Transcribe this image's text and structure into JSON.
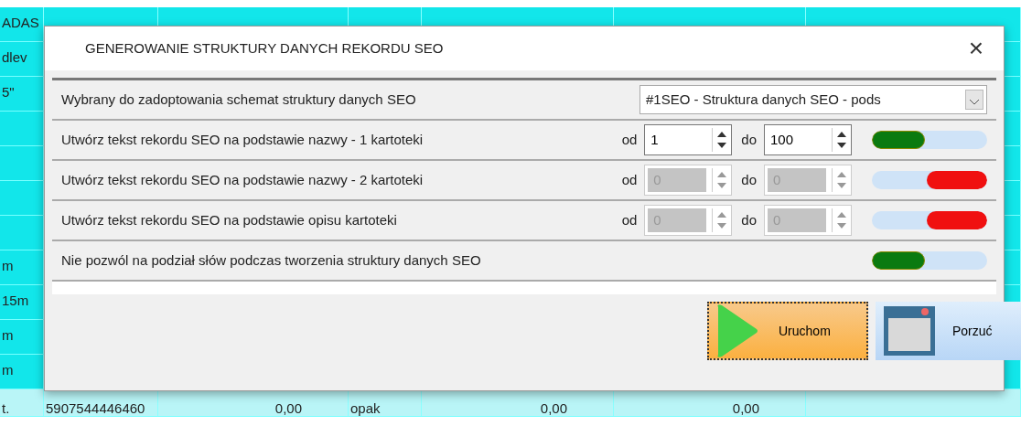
{
  "background_table": {
    "rows": [
      {
        "cells": [
          "ADAS",
          "",
          "",
          ""
        ]
      },
      {
        "cells": [
          "dlev",
          "",
          "",
          ""
        ]
      },
      {
        "cells": [
          "5\"",
          "",
          "",
          ""
        ]
      },
      {
        "cells": [
          "",
          "",
          "",
          ""
        ]
      },
      {
        "cells": [
          "",
          "",
          "",
          ""
        ]
      },
      {
        "cells": [
          "",
          "",
          "",
          ""
        ]
      },
      {
        "cells": [
          "",
          "",
          "",
          ""
        ]
      },
      {
        "cells": [
          "m",
          "",
          "",
          ""
        ]
      },
      {
        "cells": [
          "15m",
          "",
          "",
          ""
        ]
      },
      {
        "cells": [
          "m",
          "",
          "",
          ""
        ]
      },
      {
        "cells": [
          "m",
          "",
          "",
          ""
        ]
      },
      {
        "cells": [
          "t.",
          "5907544446460",
          "0,00",
          "opak",
          "0,00",
          "0,00"
        ]
      }
    ]
  },
  "dialog": {
    "title": "GENEROWANIE STRUKTURY DANYCH REKORDU SEO",
    "close": "×",
    "options": [
      {
        "kind": "select",
        "label": "Wybrany do zadoptowania schemat struktury danych SEO",
        "value": "#1SEO - Struktura danych SEO - pods"
      },
      {
        "kind": "range",
        "label": "Utwórz tekst rekordu SEO na podstawie nazwy - 1 kartoteki",
        "from_label": "od",
        "from": "1",
        "to_label": "do",
        "to": "100",
        "disabled": false,
        "on": true
      },
      {
        "kind": "range",
        "label": "Utwórz tekst rekordu SEO na podstawie nazwy - 2 kartoteki",
        "from_label": "od",
        "from": "0",
        "to_label": "do",
        "to": "0",
        "disabled": true,
        "on": false
      },
      {
        "kind": "range",
        "label": "Utwórz tekst rekordu SEO na podstawie opisu kartoteki",
        "from_label": "od",
        "from": "0",
        "to_label": "do",
        "to": "0",
        "disabled": true,
        "on": false
      },
      {
        "kind": "toggle",
        "label": "Nie pozwól na podział słów podczas tworzenia struktury danych SEO",
        "on": true
      }
    ],
    "buttons": [
      {
        "kind": "run",
        "label": "Uruchom"
      },
      {
        "kind": "cancel",
        "label": "Porzuć"
      }
    ]
  }
}
